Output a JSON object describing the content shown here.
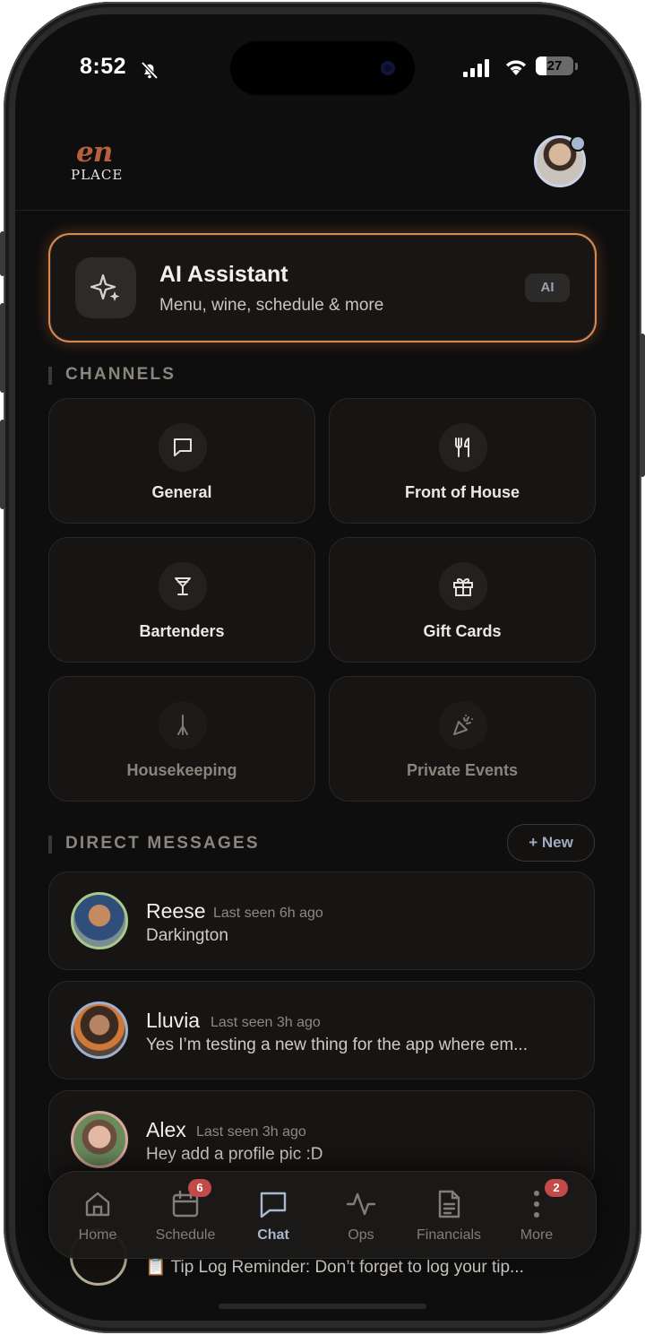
{
  "status": {
    "time": "8:52",
    "battery": "27"
  },
  "brand": {
    "logo_top": "en",
    "logo_bottom": "PLACE"
  },
  "ai": {
    "title": "AI Assistant",
    "subtitle": "Menu, wine, schedule & more",
    "badge": "AI"
  },
  "channels": {
    "heading": "CHANNELS",
    "items": [
      {
        "label": "General",
        "icon": "chat-bubble-icon",
        "muted": false
      },
      {
        "label": "Front of House",
        "icon": "fork-knife-icon",
        "muted": false
      },
      {
        "label": "Bartenders",
        "icon": "cocktail-glass-icon",
        "muted": false
      },
      {
        "label": "Gift Cards",
        "icon": "gift-icon",
        "muted": false
      },
      {
        "label": "Housekeeping",
        "icon": "broom-icon",
        "muted": true
      },
      {
        "label": "Private Events",
        "icon": "party-popper-icon",
        "muted": true
      }
    ]
  },
  "dms": {
    "heading": "DIRECT MESSAGES",
    "new_label": "+ New",
    "items": [
      {
        "name": "Reese",
        "seen": "Last seen 6h ago",
        "message": "Darkington"
      },
      {
        "name": "Lluvia",
        "seen": "Last seen 3h ago",
        "message": "Yes I’m testing a new thing for the app where em..."
      },
      {
        "name": "Alex",
        "seen": "Last seen 3h ago",
        "message": "Hey add a profile pic :D"
      }
    ],
    "partial_message": "📋 Tip Log Reminder: Don’t forget to log your tip..."
  },
  "tabbar": {
    "items": [
      {
        "label": "Home",
        "icon": "home-icon",
        "badge": ""
      },
      {
        "label": "Schedule",
        "icon": "calendar-icon",
        "badge": "6"
      },
      {
        "label": "Chat",
        "icon": "chat-icon",
        "badge": "",
        "active": true
      },
      {
        "label": "Ops",
        "icon": "activity-icon",
        "badge": ""
      },
      {
        "label": "Financials",
        "icon": "document-icon",
        "badge": ""
      },
      {
        "label": "More",
        "icon": "more-vertical-icon",
        "badge": "2"
      }
    ]
  },
  "colors": {
    "background": "#0f0e0e",
    "card": "#171514",
    "accent": "#d48a52",
    "active_tab": "#a9b8cc",
    "badge": "#c24a48"
  }
}
